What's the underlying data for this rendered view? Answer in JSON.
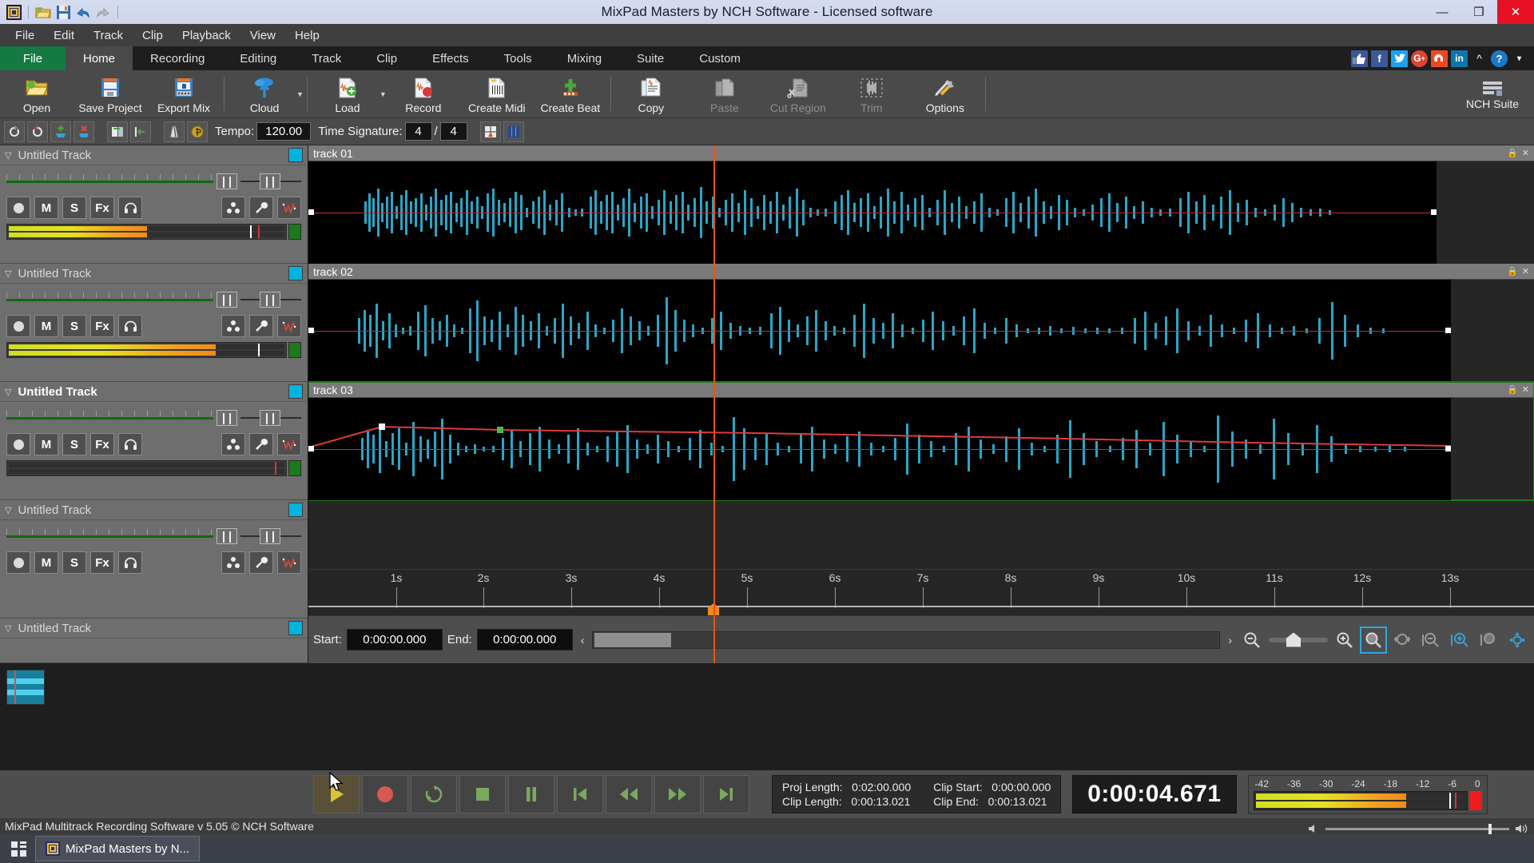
{
  "titlebar": {
    "title": "MixPad Masters by NCH Software - Licensed software",
    "quick_access": [
      "app-logo-icon",
      "open-folder-icon",
      "save-icon",
      "undo-icon",
      "redo-icon"
    ],
    "window_controls": {
      "minimize": "—",
      "maximize": "❐",
      "close": "✕"
    }
  },
  "menubar": {
    "items": [
      "File",
      "Edit",
      "Track",
      "Clip",
      "Playback",
      "View",
      "Help"
    ]
  },
  "ribbon_tabs": {
    "file": "File",
    "tabs": [
      "Home",
      "Recording",
      "Editing",
      "Track",
      "Clip",
      "Effects",
      "Tools",
      "Mixing",
      "Suite",
      "Custom"
    ],
    "active": "Home",
    "social_icons": [
      "thumbs-up-icon",
      "facebook-icon",
      "twitter-icon",
      "googleplus-icon",
      "stumbleupon-icon",
      "linkedin-icon",
      "chevron-up-icon",
      "help-icon",
      "dropdown-icon"
    ]
  },
  "ribbon": {
    "buttons": [
      {
        "label": "Open",
        "icon": "open-folder-icon",
        "enabled": true
      },
      {
        "label": "Save Project",
        "icon": "save-project-icon",
        "enabled": true
      },
      {
        "label": "Export Mix",
        "icon": "export-mix-icon",
        "enabled": true
      },
      {
        "label": "Cloud",
        "icon": "cloud-upload-icon",
        "enabled": true,
        "has_dropdown": true
      },
      {
        "label": "Load",
        "icon": "load-file-icon",
        "enabled": true,
        "has_dropdown": true
      },
      {
        "label": "Record",
        "icon": "record-icon",
        "enabled": true
      },
      {
        "label": "Create Midi",
        "icon": "create-midi-icon",
        "enabled": true
      },
      {
        "label": "Create Beat",
        "icon": "create-beat-icon",
        "enabled": true
      },
      {
        "label": "Copy",
        "icon": "copy-icon",
        "enabled": true
      },
      {
        "label": "Paste",
        "icon": "paste-icon",
        "enabled": false
      },
      {
        "label": "Cut Region",
        "icon": "cut-region-icon",
        "enabled": false
      },
      {
        "label": "Trim",
        "icon": "trim-icon",
        "enabled": false
      },
      {
        "label": "Options",
        "icon": "options-icon",
        "enabled": true
      }
    ],
    "nch_suite_label": "NCH Suite"
  },
  "tempobar": {
    "tempo_label": "Tempo:",
    "tempo_value": "120.00",
    "time_signature_label": "Time Signature:",
    "time_sig_numerator": "4",
    "time_sig_denominator": "4",
    "tool_icons": [
      "loop-start-icon",
      "loop-end-icon",
      "add-marker-icon",
      "remove-marker-icon",
      "split-icon",
      "goto-marker-icon",
      "metronome-icon",
      "beat-detect-icon",
      "snap-icon",
      "grid-icon"
    ]
  },
  "tracks": [
    {
      "name": "Untitled Track",
      "color": "#00b4e0",
      "selected": false,
      "volume_pct": 62,
      "meter_pct": 50,
      "has_clip": true,
      "clip_name": "track 01"
    },
    {
      "name": "Untitled Track",
      "color": "#00b4e0",
      "selected": false,
      "volume_pct": 62,
      "meter_pct": 72,
      "has_clip": true,
      "clip_name": "track 02"
    },
    {
      "name": "Untitled Track",
      "color": "#00b4e0",
      "selected": true,
      "volume_pct": 62,
      "meter_pct": 0,
      "has_clip": true,
      "clip_name": "track 03"
    },
    {
      "name": "Untitled Track",
      "color": "#00b4e0",
      "selected": false,
      "volume_pct": 62,
      "meter_pct": 0,
      "has_clip": false,
      "clip_name": ""
    },
    {
      "name": "Untitled Track",
      "color": "#00b4e0",
      "selected": false,
      "volume_pct": 62,
      "meter_pct": 0,
      "has_clip": false,
      "clip_name": ""
    }
  ],
  "track_buttons": {
    "record": "●",
    "mute": "M",
    "solo": "S",
    "fx": "Fx",
    "monitor": "headphones-icon",
    "right_icons": [
      "mixer-icon",
      "settings-wrench-icon",
      "envelope-waveform-icon"
    ]
  },
  "timeline": {
    "tick_labels": [
      "1s",
      "2s",
      "3s",
      "4s",
      "5s",
      "6s",
      "7s",
      "8s",
      "9s",
      "10s",
      "11s",
      "12s",
      "13s"
    ],
    "playhead_time_s": 4.671
  },
  "selection_bar": {
    "start_label": "Start:",
    "start_value": "0:00:00.000",
    "end_label": "End:",
    "end_value": "0:00:00.000",
    "zoom_icons": [
      "zoom-out-icon",
      "zoom-slider",
      "zoom-in-icon",
      "zoom-select-icon",
      "zoom-fit-horizontal-icon",
      "zoom-out-region-icon",
      "zoom-in-region-icon",
      "zoom-region-icon",
      "zoom-reset-icon"
    ],
    "active_zoom_tool": "zoom-select-icon"
  },
  "transport": {
    "buttons": [
      "play-button",
      "record-button",
      "loop-button",
      "stop-button",
      "pause-button",
      "skip-start-button",
      "rewind-button",
      "fast-forward-button",
      "skip-end-button"
    ],
    "active": "play-button",
    "info": {
      "proj_length_label": "Proj Length:",
      "proj_length_value": "0:02:00.000",
      "clip_length_label": "Clip Length:",
      "clip_length_value": "0:00:13.021",
      "clip_start_label": "Clip Start:",
      "clip_start_value": "0:00:00.000",
      "clip_end_label": "Clip End:",
      "clip_end_value": "0:00:13.021"
    },
    "big_time": "0:00:04.671",
    "master_meter": {
      "scale": [
        "-42",
        "-36",
        "-30",
        "-24",
        "-18",
        "-12",
        "-6",
        "0"
      ],
      "level_pct": 72
    }
  },
  "statusbar": {
    "text": "MixPad Multitrack Recording Software v 5.05 © NCH Software"
  },
  "taskbar": {
    "start_icon": "windows-start-icon",
    "items": [
      {
        "label": "MixPad Masters by N...",
        "icon": "mixpad-icon"
      }
    ]
  },
  "colors": {
    "accent_green": "#147a42",
    "waveform": "#2aa6c8",
    "playhead": "#e8540c",
    "envelope_red": "#e03a3a",
    "track_swatch": "#00b4e0",
    "meter_gradient_start": "#cfe021",
    "meter_gradient_end": "#ef8b1c"
  }
}
